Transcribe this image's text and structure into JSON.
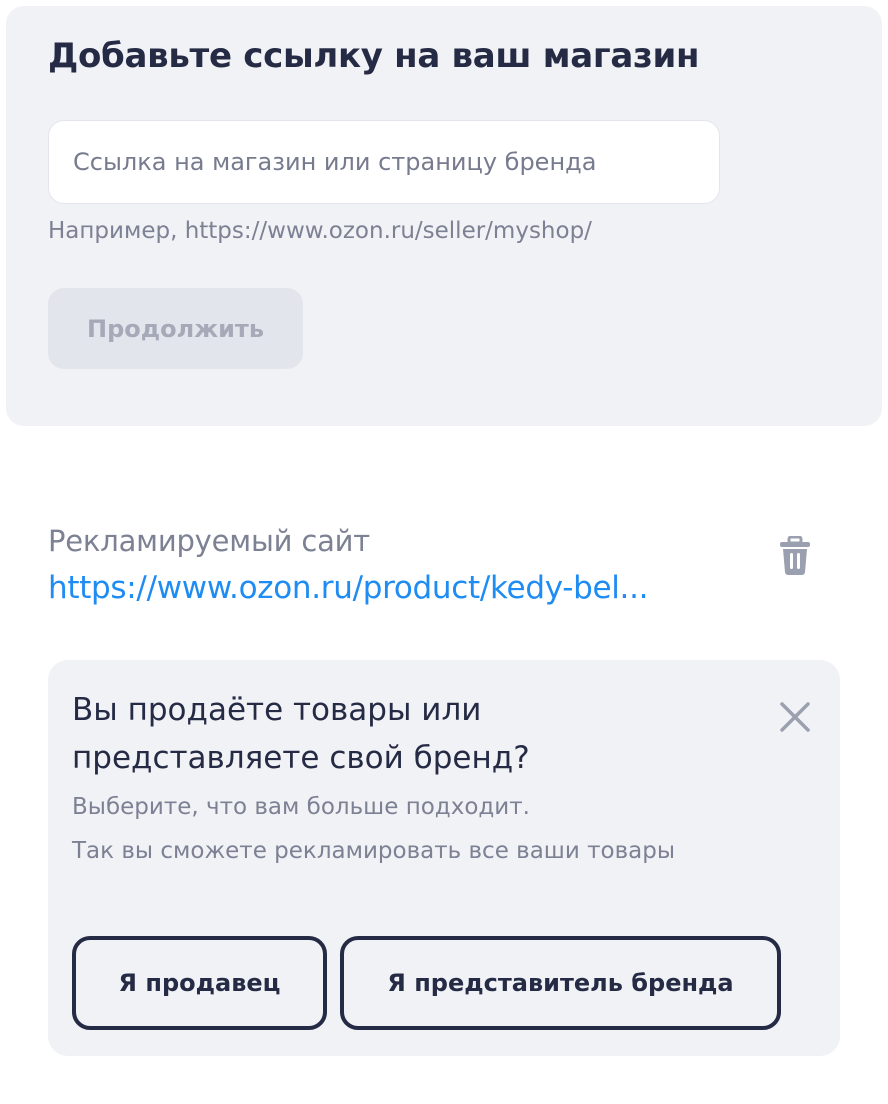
{
  "shop_card": {
    "title": "Добавьте ссылку на ваш магазин",
    "input_placeholder": "Ссылка на магазин или страницу бренда",
    "input_value": "",
    "hint": "Например, https://www.ozon.ru/seller/myshop/",
    "continue_label": "Продолжить"
  },
  "site": {
    "label": "Рекламируемый сайт",
    "url": "https://www.ozon.ru/product/kedy-bel...",
    "delete_icon": "trash-icon"
  },
  "choice_card": {
    "title": "Вы продаёте товары или представляете свой бренд?",
    "description_line1": "Выберите, что вам больше подходит.",
    "description_line2": "Так вы сможете рекламировать все ваши товары",
    "close_icon": "close-icon",
    "seller_label": "Я продавец",
    "brand_label": "Я представитель бренда"
  },
  "colors": {
    "card_background": "#f1f2f6",
    "text_primary": "#262b45",
    "text_secondary": "#7c8193",
    "link": "#1e8cf2",
    "disabled_button_bg": "#e3e5ec",
    "disabled_button_text": "#a6aab8",
    "icon_gray": "#9aa0af"
  }
}
